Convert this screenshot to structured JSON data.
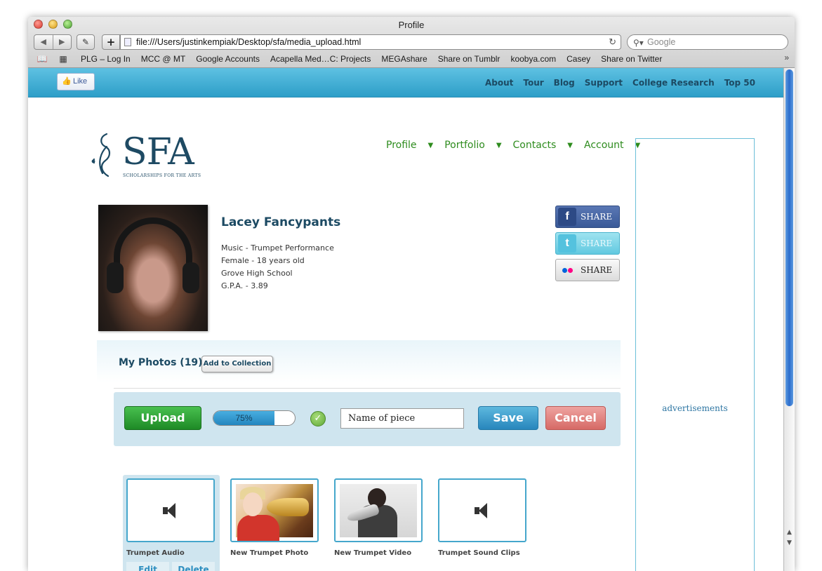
{
  "window": {
    "title": "Profile"
  },
  "toolbar": {
    "back": "◀",
    "forward": "▶",
    "evernote": "✎",
    "add": "+",
    "url": "file:///Users/justinkempiak/Desktop/sfa/media_upload.html",
    "reload": "↻",
    "search_placeholder": "Google"
  },
  "bookmarks": {
    "items": [
      "PLG – Log In",
      "MCC @ MT",
      "Google Accounts",
      "Acapella Med…C: Projects",
      "MEGAshare",
      "Share on Tumblr",
      "koobya.com",
      "Casey",
      "Share on Twitter"
    ],
    "more": "»"
  },
  "topbar": {
    "like_label": "Like",
    "nav": [
      "About",
      "Tour",
      "Blog",
      "Support",
      "College Research",
      "Top 50"
    ]
  },
  "logo": {
    "text": "SFA",
    "subtitle": "SCHOLARSHIPS FOR THE ARTS"
  },
  "mainnav": {
    "items": [
      "Profile",
      "Portfolio",
      "Contacts",
      "Account"
    ],
    "caret": "▼"
  },
  "profile": {
    "name": "Lacey Fancypants",
    "details": [
      "Music - Trumpet Performance",
      "Female - 18 years old",
      "Grove High School",
      "G.P.A. - 3.89"
    ]
  },
  "share": {
    "label": "SHARE",
    "facebook_icon": "f",
    "twitter_icon": "t"
  },
  "photos": {
    "title": "My Photos (19)",
    "add_to_collection": "Add to Collection"
  },
  "upload": {
    "upload_label": "Upload",
    "progress_value": 75,
    "progress_text": "75%",
    "check": "✓",
    "name_value": "Name of piece",
    "save_label": "Save",
    "cancel_label": "Cancel"
  },
  "media": [
    {
      "caption": "Trumpet Audio",
      "kind": "audio",
      "active": true
    },
    {
      "caption": "New Trumpet Photo",
      "kind": "photo",
      "active": false
    },
    {
      "caption": "New Trumpet Video",
      "kind": "video",
      "active": false
    },
    {
      "caption": "Trumpet Sound Clips",
      "kind": "audio",
      "active": false
    }
  ],
  "media_actions": {
    "edit": "Edit",
    "delete": "Delete"
  },
  "ads": {
    "label": "advertisements"
  },
  "colors": {
    "accent_blue": "#2d9ec8",
    "nav_green": "#2e8c1e",
    "brand_navy": "#1e4a63",
    "upload_green": "#1e8a26",
    "save_blue": "#2886bc",
    "cancel_red": "#d66a66"
  }
}
